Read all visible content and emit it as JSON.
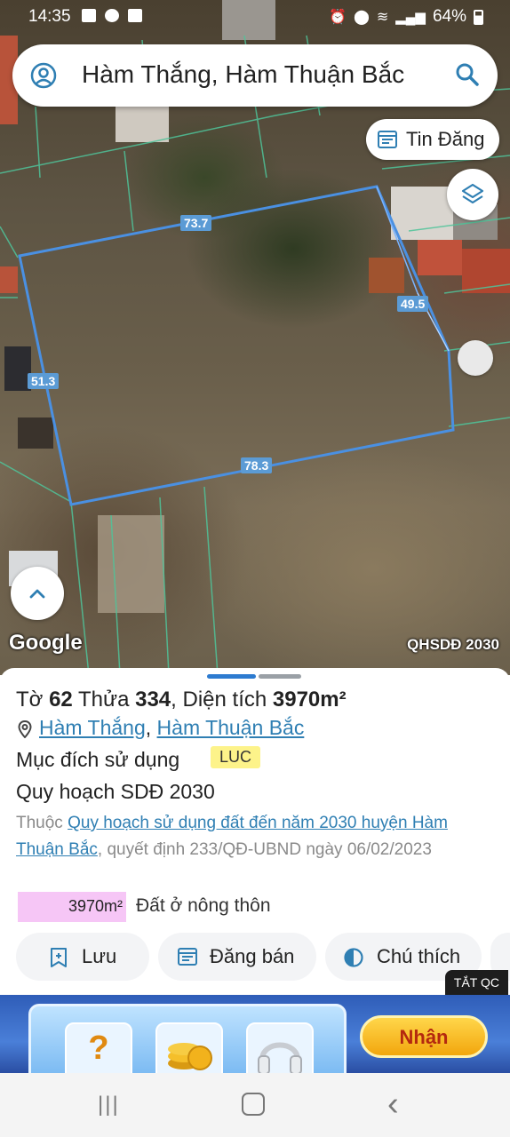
{
  "status_bar": {
    "time": "14:35",
    "battery": "64%"
  },
  "search": {
    "query": "Hàm Thắng, Hàm Thuận Bắc"
  },
  "map": {
    "tin_dang_label": "Tin Đăng",
    "google_label": "Google",
    "layer_tag": "QHSDĐ 2030",
    "dimensions": {
      "top": "73.7",
      "right": "49.5",
      "left": "51.3",
      "bottom": "78.3"
    },
    "parcel_outline_color": "#4a90e2"
  },
  "parcel": {
    "to_label": "Tờ",
    "to": "62",
    "thua_label": "Thửa",
    "thua": "334",
    "dien_tich_label": ", Diện tích",
    "dien_tich": "3970m²",
    "commune": "Hàm Thắng",
    "separator": ",",
    "district": "Hàm Thuận Bắc",
    "muc_dich_label": "Mục đích sử dụng",
    "muc_dich_code": "LUC",
    "quy_hoach_title": "Quy hoạch SDĐ 2030",
    "desc_prefix": "Thuộc",
    "desc_link": "Quy hoạch sử dụng đất đến năm 2030 huyện Hàm Thuận Bắc",
    "desc_suffix": ", quyết định 233/QĐ-UBND ngày 06/02/2023",
    "area_value": "3970m²",
    "area_type": "Đất ở nông thôn",
    "area_color": "#f6c6f6"
  },
  "actions": {
    "save": "Lưu",
    "sell": "Đăng bán",
    "legend": "Chú thích"
  },
  "ad": {
    "tag": "TẮT QC",
    "claim_label": "Nhận",
    "tile_glyph": "?"
  },
  "nav": {
    "recent": "|||",
    "back": "‹"
  }
}
